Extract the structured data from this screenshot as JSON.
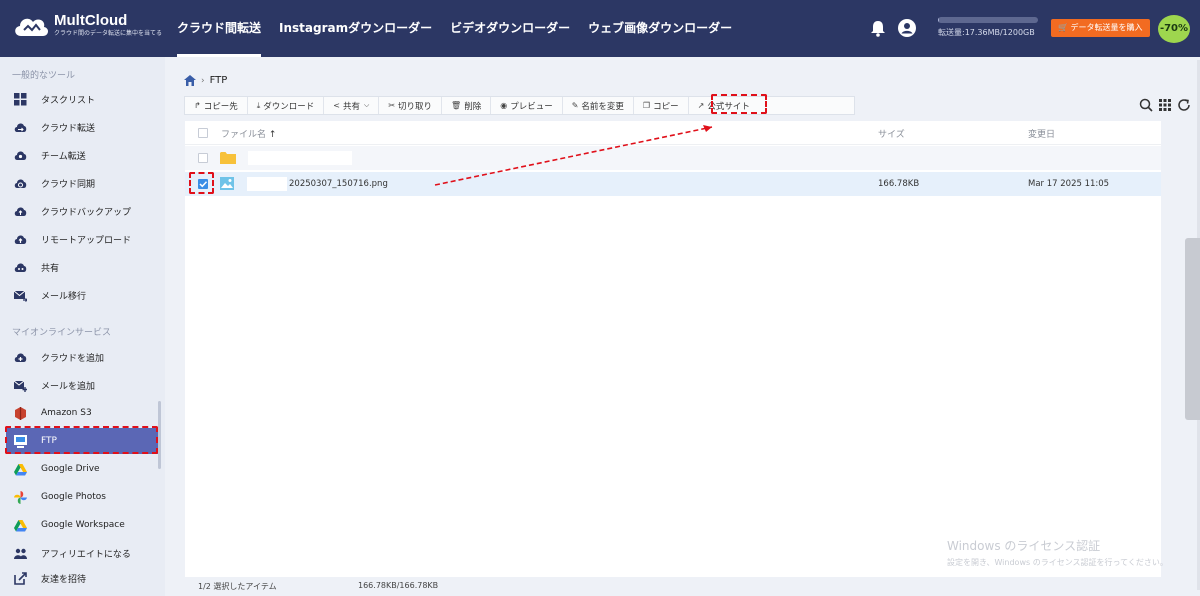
{
  "brand": {
    "name": "MultCloud",
    "tagline": "クラウド間のデータ転送に集中を当てる"
  },
  "nav": [
    "クラウド間転送",
    "Instagramダウンローダー",
    "ビデオダウンローダー",
    "ウェブ画像ダウンローダー"
  ],
  "quota": {
    "label": "転送量:17.36MB/1200GB",
    "fraction": 1e-05
  },
  "buy_label": "データ転送量を購入",
  "discount": "-70%",
  "sidebar": {
    "section1": "一般的なツール",
    "tools": [
      "タスクリスト",
      "クラウド転送",
      "チーム転送",
      "クラウド同期",
      "クラウドバックアップ",
      "リモートアップロード",
      "共有",
      "メール移行"
    ],
    "section2": "マイオンラインサービス",
    "services": [
      "クラウドを追加",
      "メールを追加",
      "Amazon S3",
      "FTP",
      "Google Drive",
      "Google Photos",
      "Google Workspace",
      "アフィリエイトになる",
      "友達を招待"
    ]
  },
  "breadcrumb": {
    "current": "FTP"
  },
  "toolbar": [
    "コピー先",
    "ダウンロード",
    "共有",
    "切り取り",
    "削除",
    "プレビュー",
    "名前を変更",
    "コピー",
    "公式サイト"
  ],
  "table": {
    "headers": {
      "name": "ファイル名",
      "size": "サイズ",
      "date": "変更日"
    },
    "file": {
      "name": "20250307_150716.png",
      "size": "166.78KB",
      "date": "Mar 17 2025 11:05"
    }
  },
  "status": {
    "selected": "1/2 選択したアイテム",
    "size": "166.78KB/166.78KB"
  },
  "watermark": {
    "title": "Windows のライセンス認証",
    "sub": "設定を開き、Windows のライセンス認証を行ってください。"
  }
}
